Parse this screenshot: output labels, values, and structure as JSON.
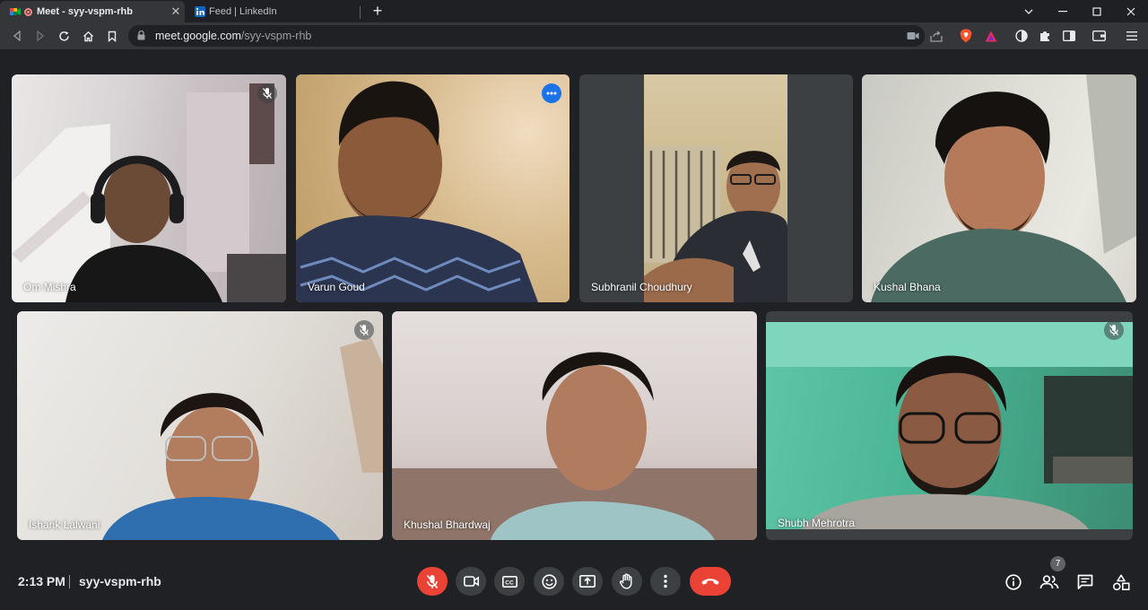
{
  "browser": {
    "tabs": [
      {
        "title": "Meet - syy-vspm-rhb",
        "active": true
      },
      {
        "title": "Feed | LinkedIn",
        "active": false
      }
    ],
    "url_host": "meet.google.com",
    "url_path": "/syy-vspm-rhb",
    "accent_colors": {
      "brave": "#fb542b",
      "linkedin": "#0a66c2"
    }
  },
  "participants": [
    {
      "name": "Om Mishra",
      "muted": true
    },
    {
      "name": "Varun Goud",
      "muted": false,
      "speaking": true
    },
    {
      "name": "Subhranil Choudhury",
      "muted": false
    },
    {
      "name": "Kushal Bhana",
      "muted": false
    },
    {
      "name": "Ishank Lalwani",
      "muted": true
    },
    {
      "name": "Khushal Bhardwaj",
      "muted": false
    },
    {
      "name": "Shubh Mehrotra",
      "muted": true
    }
  ],
  "bottom_bar": {
    "time": "2:13 PM",
    "meeting_code": "syy-vspm-rhb",
    "people_count": "7",
    "controls": [
      "mic-off-icon",
      "camera-icon",
      "captions-icon",
      "emoji-icon",
      "present-icon",
      "raise-hand-icon",
      "more-options-icon",
      "end-call-icon"
    ],
    "right_icons": [
      "info-icon",
      "people-icon",
      "chat-icon",
      "activities-icon"
    ]
  },
  "colors": {
    "end_call": "#ea4335",
    "speaking_outline": "#8ab4f8",
    "more_button": "#1a73e8"
  }
}
